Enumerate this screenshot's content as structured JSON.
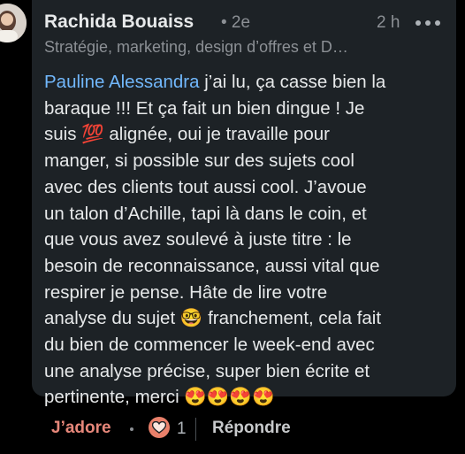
{
  "comment": {
    "author": "Rachida Bouaiss",
    "degree": "• 2e",
    "time": "2 h",
    "headline": "Stratégie, marketing, design d’offres et D…",
    "mention": "Pauline Alessandra",
    "text": " j’ai lu, ça casse bien la\nbaraque !!! Et ça fait un bien dingue ! Je\nsuis 💯 alignée, oui je travaille pour\nmanger, si possible sur des sujets cool\navec des clients tout aussi cool. J’avoue\nun talon d’Achille, tapi là dans le coin, et\nque vous avez soulevé à juste titre : le\nbesoin de reconnaissance, aussi vital que\nrespirer je pense. Hâte de lire votre\nanalyse du sujet 🤓 franchement, cela fait\ndu bien de commencer le week-end avec\nune analyse précise, super bien écrite et\npertinente, merci 😍😍😍😍"
  },
  "actions": {
    "reaction_label": "J’adore",
    "separator": "•",
    "reaction_count": "1",
    "reply_label": "Répondre"
  },
  "colors": {
    "card_bg": "#1d2226",
    "mention": "#71b7fb",
    "reaction": "#e6877a"
  },
  "icons": {
    "avatar": "avatar",
    "more": "more-options-icon",
    "love": "heart-reaction-icon"
  }
}
